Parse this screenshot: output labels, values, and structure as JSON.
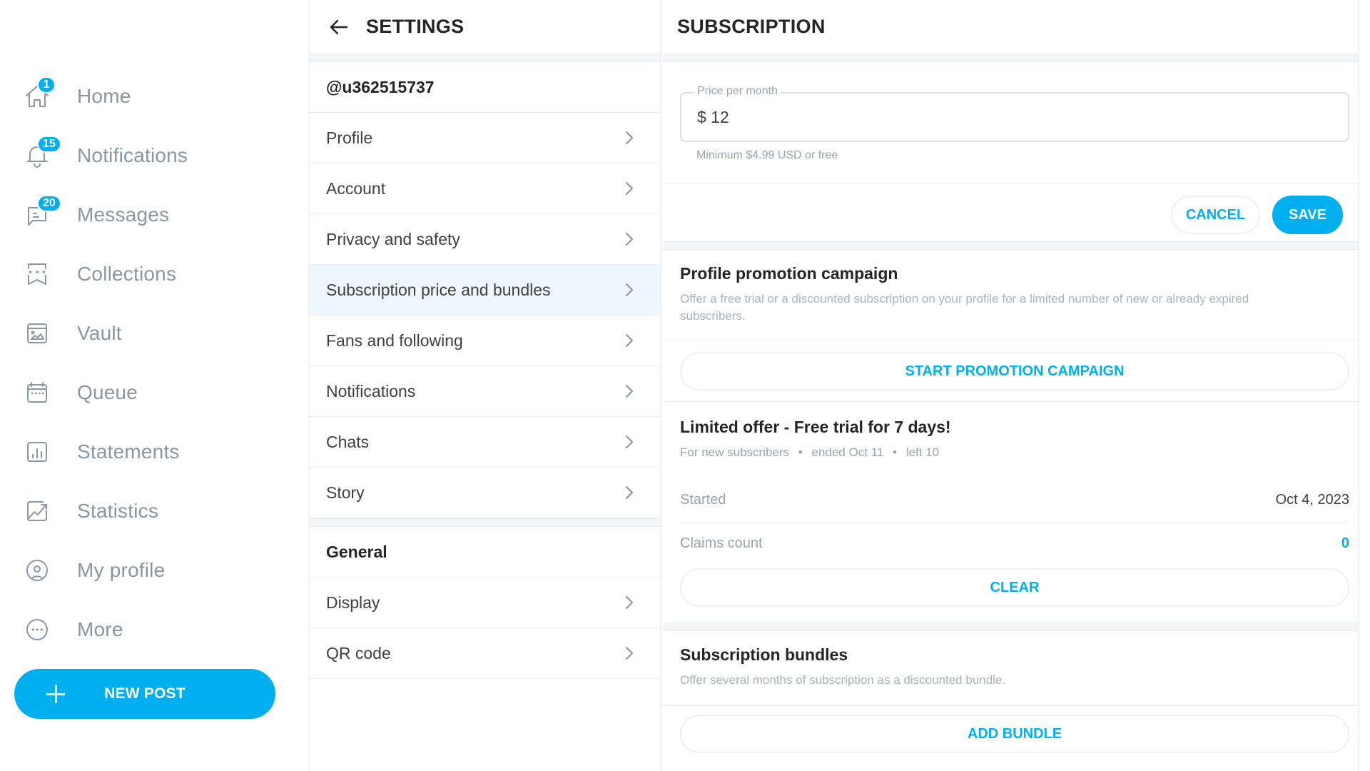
{
  "sidebar": {
    "items": [
      {
        "label": "Home",
        "icon": "home-icon",
        "badge": "1"
      },
      {
        "label": "Notifications",
        "icon": "bell-icon",
        "badge": "15"
      },
      {
        "label": "Messages",
        "icon": "message-icon",
        "badge": "20"
      },
      {
        "label": "Collections",
        "icon": "bookmark-stars-icon",
        "badge": null
      },
      {
        "label": "Vault",
        "icon": "image-icon",
        "badge": null
      },
      {
        "label": "Queue",
        "icon": "calendar-icon",
        "badge": null
      },
      {
        "label": "Statements",
        "icon": "bar-chart-icon",
        "badge": null
      },
      {
        "label": "Statistics",
        "icon": "trend-chart-icon",
        "badge": null
      },
      {
        "label": "My profile",
        "icon": "user-circle-icon",
        "badge": null
      },
      {
        "label": "More",
        "icon": "more-icon",
        "badge": null
      }
    ],
    "new_post_label": "NEW POST"
  },
  "settings": {
    "title": "SETTINGS",
    "username": "@u362515737",
    "items": [
      {
        "label": "Profile"
      },
      {
        "label": "Account"
      },
      {
        "label": "Privacy and safety"
      },
      {
        "label": "Subscription price and bundles",
        "active": true
      },
      {
        "label": "Fans and following"
      },
      {
        "label": "Notifications"
      },
      {
        "label": "Chats"
      },
      {
        "label": "Story"
      }
    ],
    "general_label": "General",
    "general_items": [
      {
        "label": "Display"
      },
      {
        "label": "QR code"
      }
    ]
  },
  "subscription": {
    "title": "SUBSCRIPTION",
    "price_label": "Price per month",
    "price_value": "$ 12",
    "price_hint": "Minimum $4.99 USD or free",
    "cancel_label": "CANCEL",
    "save_label": "SAVE",
    "promotion": {
      "title": "Profile promotion campaign",
      "description": "Offer a free trial or a discounted subscription on your profile for a limited number of new or already expired subscribers.",
      "button_label": "START PROMOTION CAMPAIGN"
    },
    "offer": {
      "title": "Limited offer - Free trial for 7 days!",
      "audience": "For new subscribers",
      "ended": "ended Oct 11",
      "left": "left 10",
      "separator": "•",
      "started_label": "Started",
      "started_value": "Oct 4, 2023",
      "claims_label": "Claims count",
      "claims_value": "0",
      "clear_label": "CLEAR"
    },
    "bundles": {
      "title": "Subscription bundles",
      "description": "Offer several months of subscription as a discounted bundle.",
      "button_label": "ADD BUNDLE"
    }
  },
  "colors": {
    "accent": "#00aff0",
    "nav_gray": "#8a96a3",
    "active_row": "#eef7fe"
  }
}
